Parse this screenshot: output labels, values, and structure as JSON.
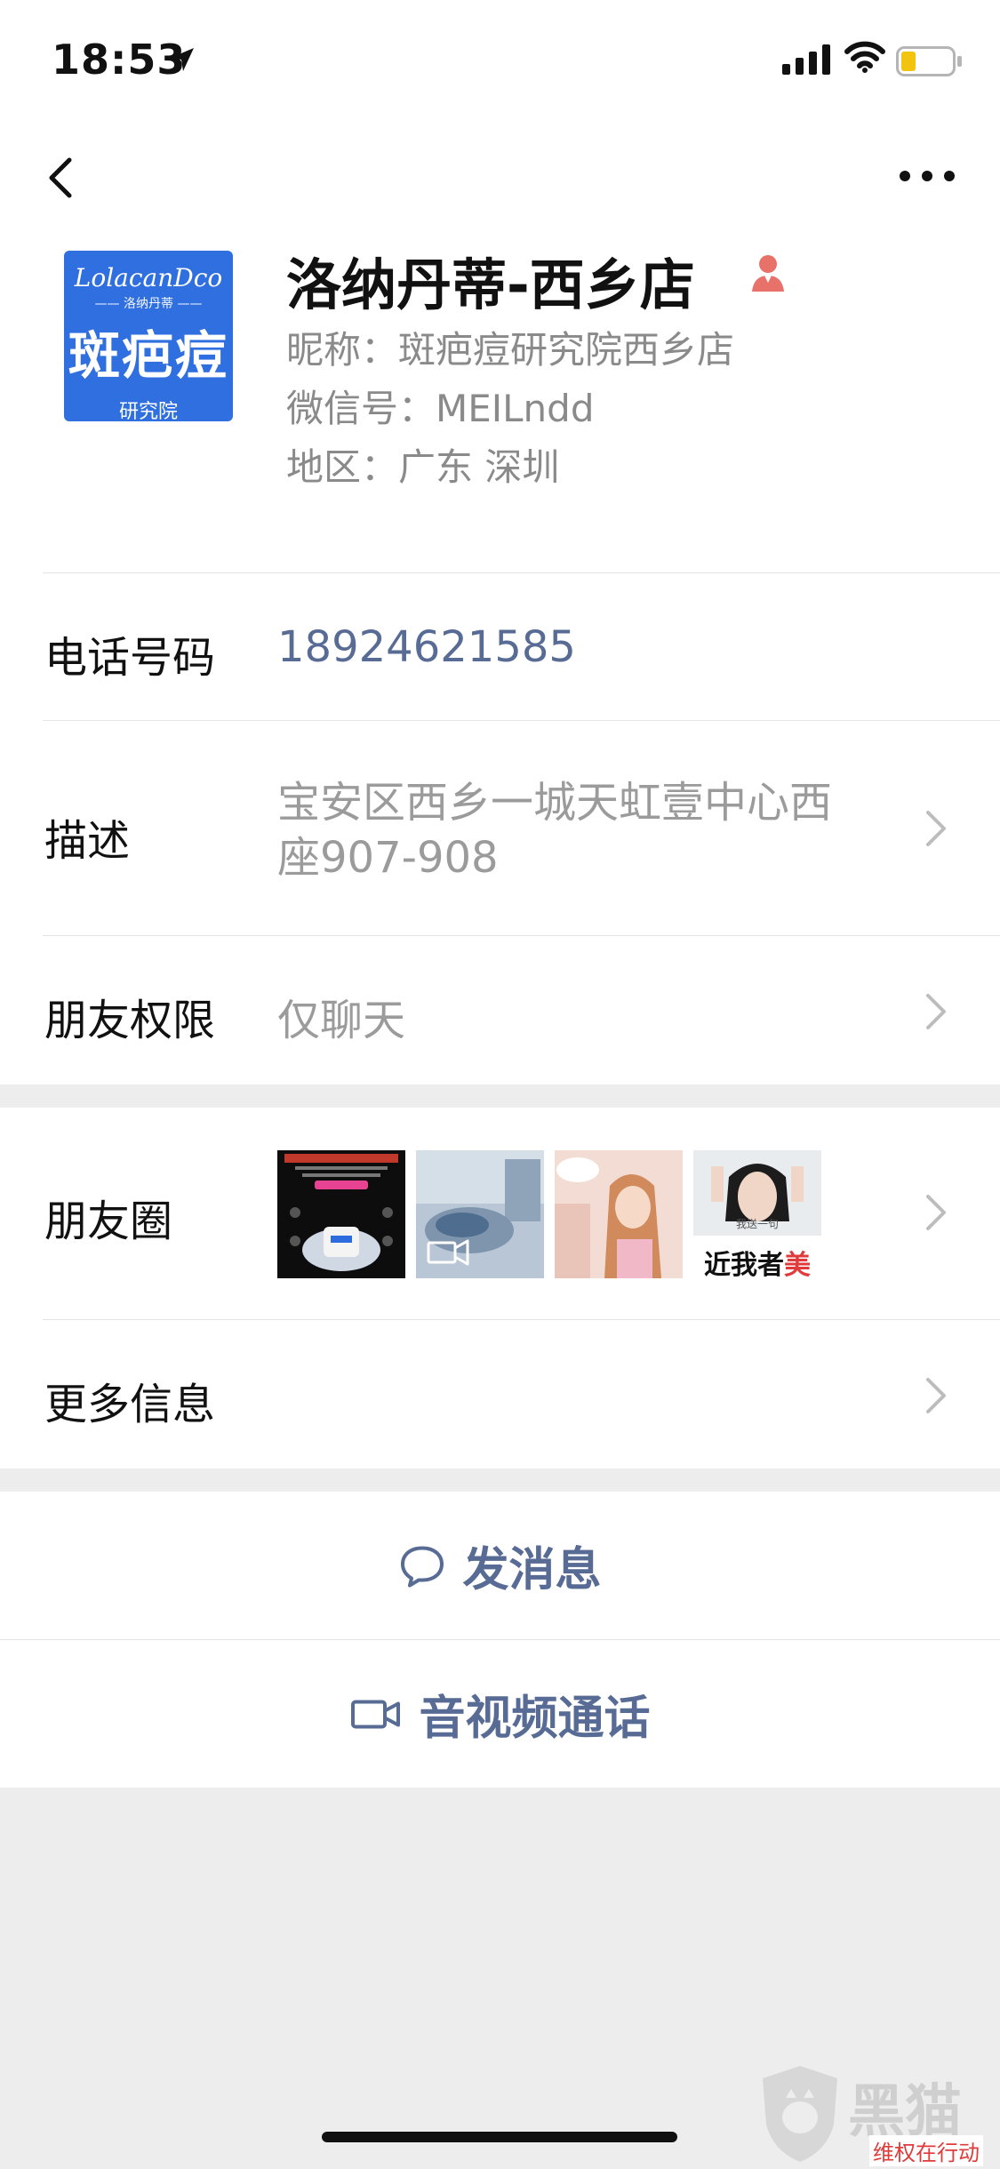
{
  "status_bar": {
    "time": "18:53"
  },
  "profile": {
    "name": "洛纳丹蒂-西乡店",
    "nickname": "昵称：斑疤痘研究院西乡店",
    "wechat_id": "微信号：MEILndd",
    "region": "地区：广东 深圳",
    "avatar": {
      "brand": "LolacanDco",
      "brand_sub": "—— 洛纳丹蒂 ——",
      "main": "斑疤痘",
      "sub": "研究院"
    }
  },
  "rows": {
    "phone": {
      "label": "电话号码",
      "value": "18924621585"
    },
    "description": {
      "label": "描述",
      "value_line1": "宝安区西乡一城天虹壹中心西",
      "value_line2": "座907-908"
    },
    "permissions": {
      "label": "朋友权限",
      "value": "仅聊天"
    }
  },
  "moments": {
    "label": "朋友圈",
    "thumbs": [
      {
        "icon": "promo-poster-thumbnail"
      },
      {
        "icon": "video-thumbnail"
      },
      {
        "icon": "portrait-thumbnail"
      },
      {
        "icon": "meme-thumbnail",
        "caption_a": "近我者",
        "caption_b": "美",
        "small_text": "我送一句"
      }
    ]
  },
  "more_info": {
    "label": "更多信息"
  },
  "actions": {
    "message": {
      "label": "发消息"
    },
    "call": {
      "label": "音视频通话"
    }
  },
  "watermark": {
    "text": "黑猫",
    "sub": "维权在行动"
  },
  "colors": {
    "link": "#576b95",
    "background": "#ededed",
    "avatar_blue": "#2f6fe0"
  }
}
